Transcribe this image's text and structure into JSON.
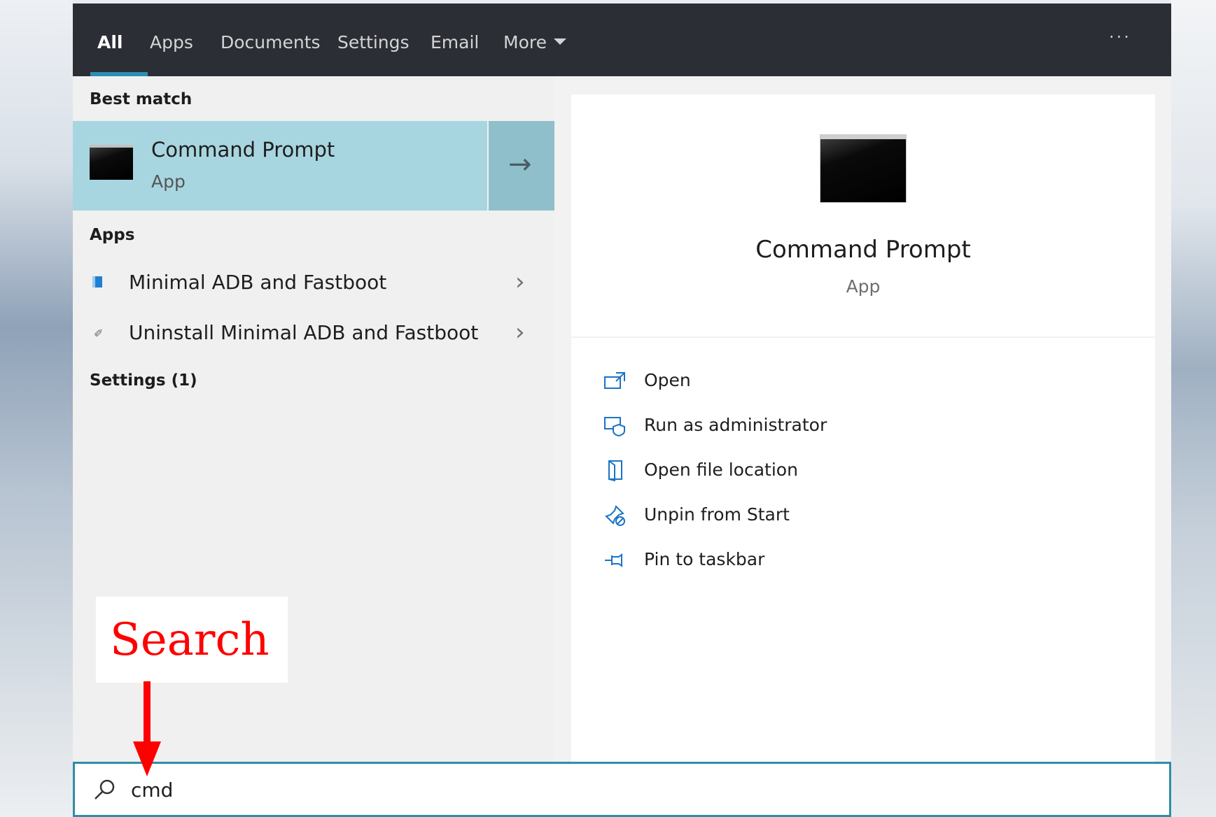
{
  "tabs": [
    {
      "label": "All",
      "active": true
    },
    {
      "label": "Apps"
    },
    {
      "label": "Documents"
    },
    {
      "label": "Settings"
    },
    {
      "label": "Email"
    },
    {
      "label": "More"
    }
  ],
  "more_menu_icon": "ellipsis-icon",
  "best_match": {
    "heading": "Best match",
    "title": "Command Prompt",
    "subtitle": "App",
    "icon": "command-prompt-icon",
    "arrow_icon": "arrow-right-icon"
  },
  "apps_section": {
    "heading": "Apps",
    "items": [
      {
        "label": "Minimal ADB and Fastboot",
        "icon": "adb-icon"
      },
      {
        "label": "Uninstall Minimal ADB and Fastboot",
        "icon": "uninstall-icon"
      }
    ]
  },
  "settings_section": {
    "heading": "Settings (1)"
  },
  "detail": {
    "title": "Command Prompt",
    "subtitle": "App",
    "actions": [
      {
        "label": "Open",
        "icon": "open-icon"
      },
      {
        "label": "Run as administrator",
        "icon": "shield-admin-icon"
      },
      {
        "label": "Open file location",
        "icon": "file-location-icon"
      },
      {
        "label": "Unpin from Start",
        "icon": "unpin-icon"
      },
      {
        "label": "Pin to taskbar",
        "icon": "pin-taskbar-icon"
      }
    ]
  },
  "search": {
    "value": "cmd",
    "icon": "search-icon"
  },
  "annotation": {
    "text": "Search",
    "color": "#ff0000"
  },
  "colors": {
    "tabbar_bg": "#2b2e35",
    "accent": "#2d8eb4",
    "selected_bg": "#a8d6e0"
  }
}
